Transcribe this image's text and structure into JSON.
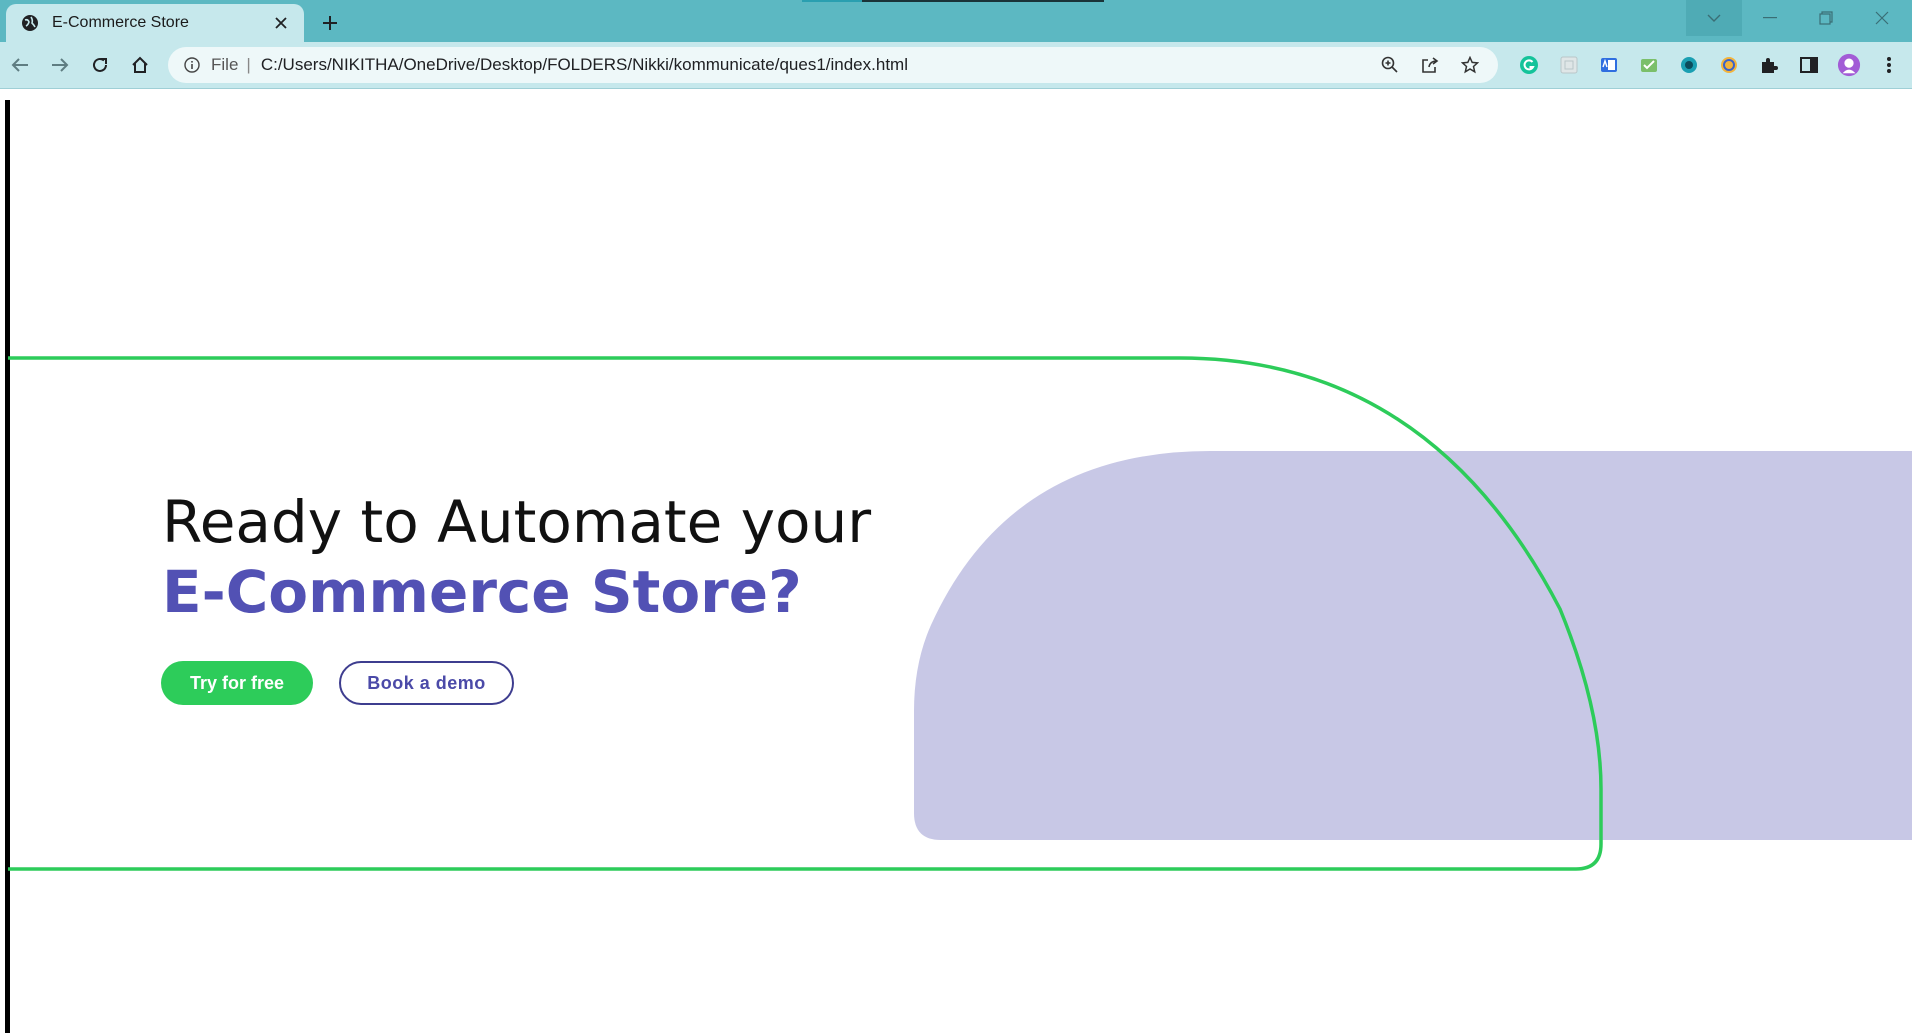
{
  "browser": {
    "tab_title": "E-Commerce Store",
    "scheme_label": "File",
    "url": "C:/Users/NIKITHA/OneDrive/Desktop/FOLDERS/Nikki/kommunicate/ques1/index.html",
    "accent": "#5cb8c2",
    "toolbar_bg": "#c6e8ec"
  },
  "hero": {
    "line1": "Ready to Automate your",
    "line2": "E-Commerce Store?",
    "primary_button": "Try for free",
    "secondary_button": "Book a demo"
  },
  "colors": {
    "brand_purple": "#5251b4",
    "brand_green": "#2dcc5a",
    "shape_lavender": "#c8c8e6"
  }
}
